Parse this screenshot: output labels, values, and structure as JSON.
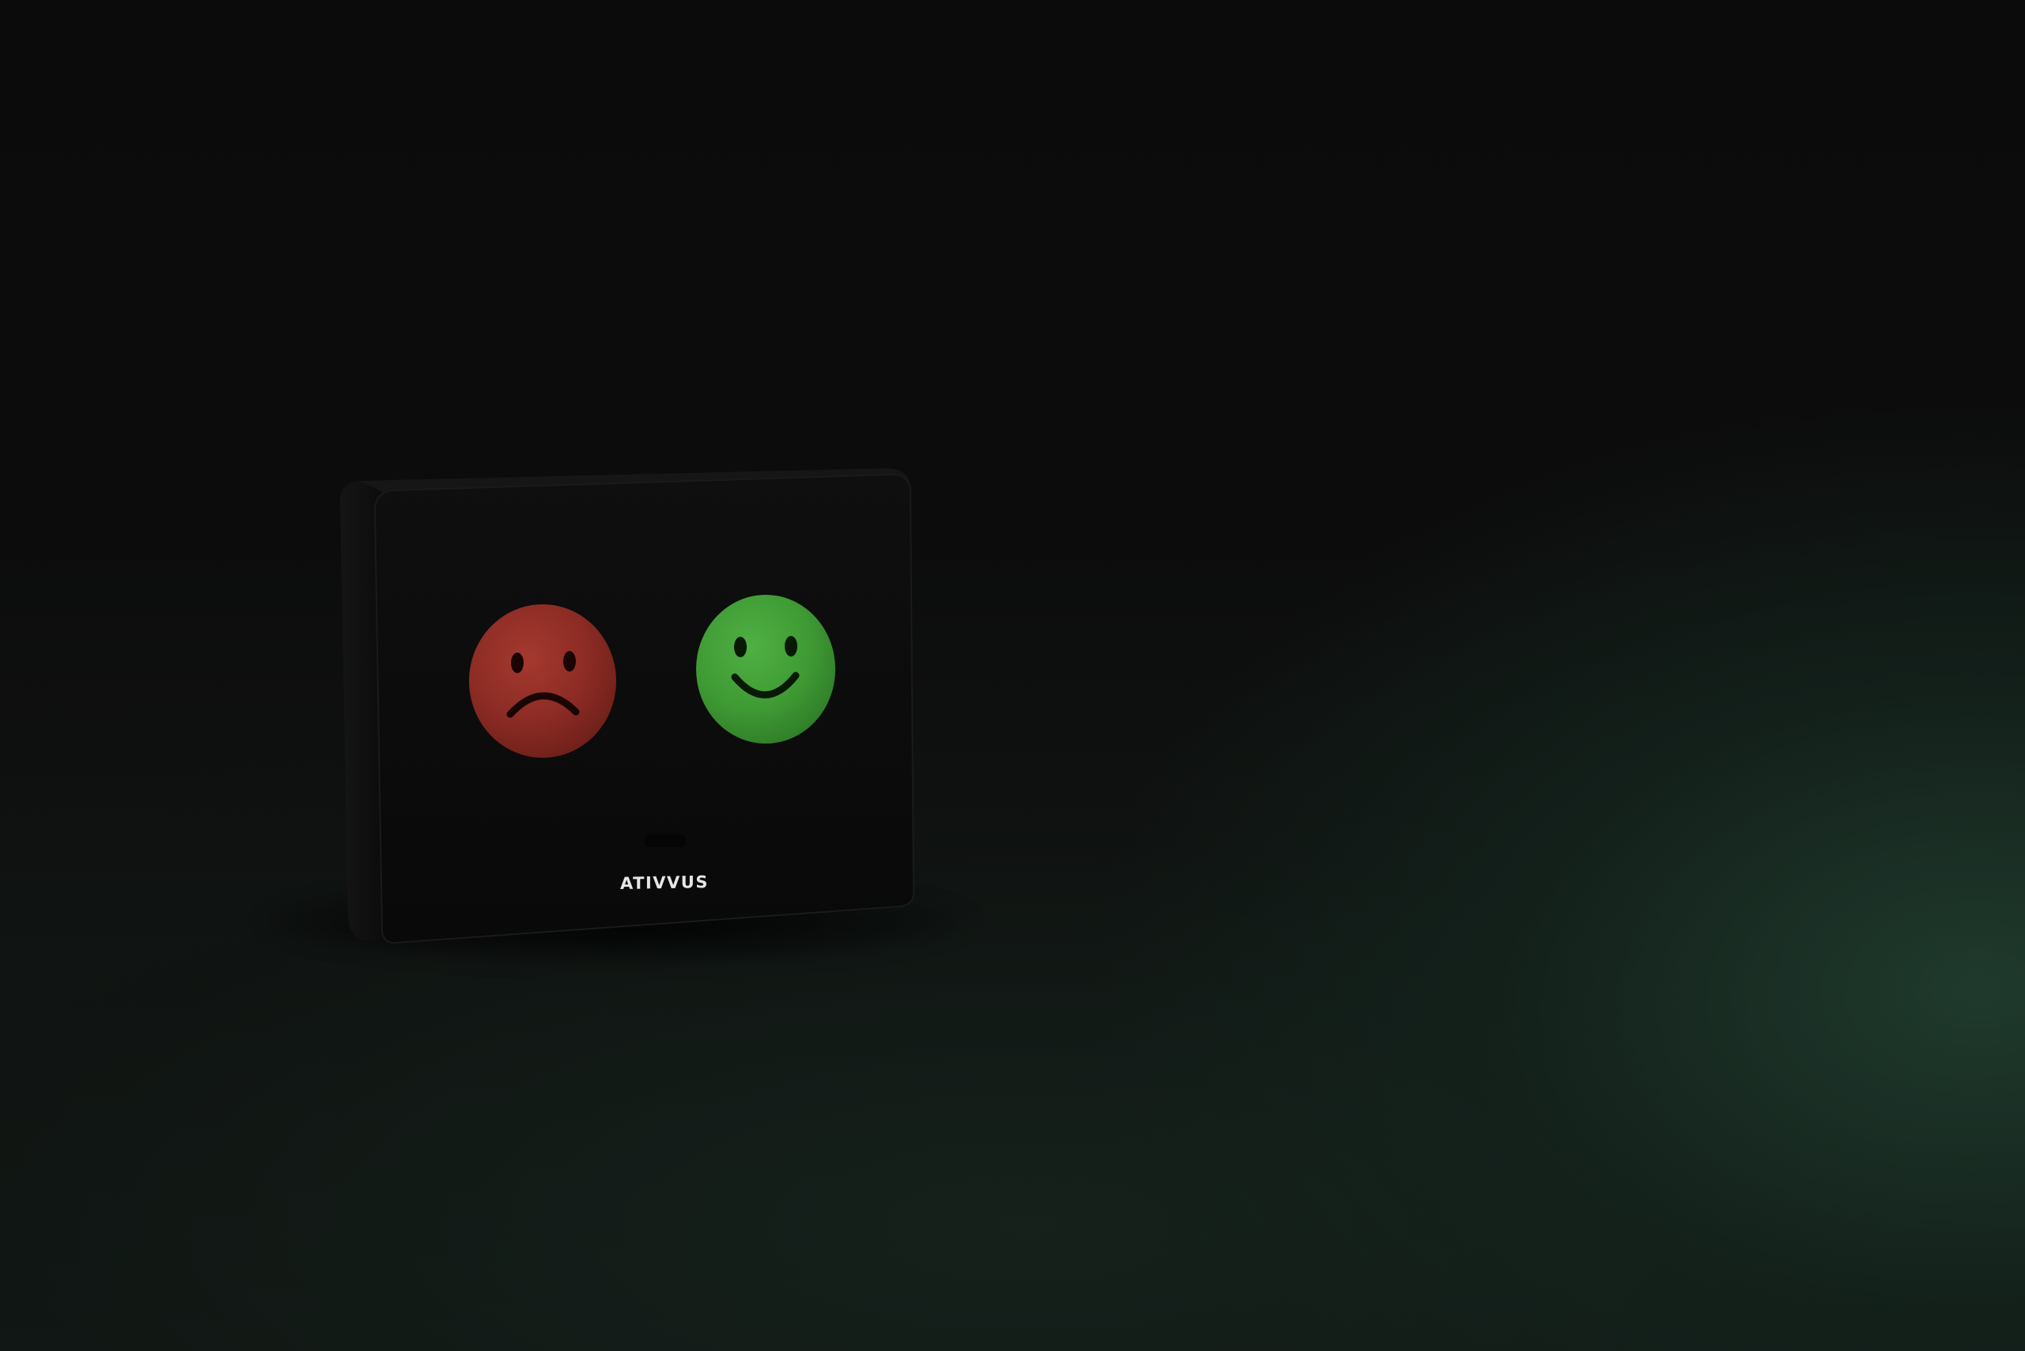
{
  "device": {
    "brand_text": "ATIVVUS",
    "body_color": "#0d0d0d",
    "buttons": [
      {
        "mood": "unhappy",
        "icon": "sad-face-icon",
        "color": "#8a2a22"
      },
      {
        "mood": "happy",
        "icon": "smiley-face-icon",
        "color": "#3f9a34"
      }
    ]
  },
  "background": {
    "top_color": "#0b0b0b",
    "glow_color": "#1c3a2c"
  }
}
